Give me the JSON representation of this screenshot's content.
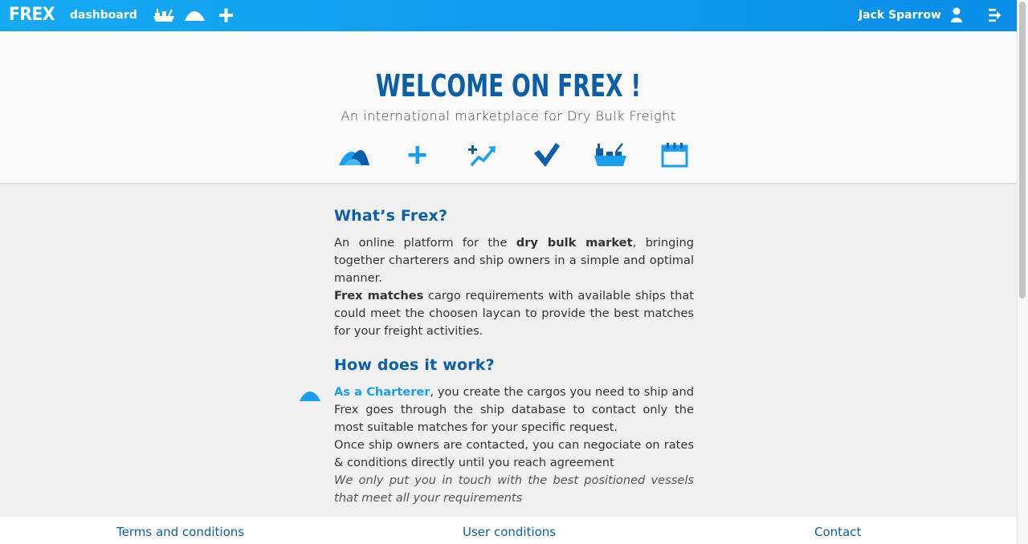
{
  "navbar": {
    "brand": "FREX",
    "dashboard_label": "dashboard",
    "icons": [
      "ship-icon",
      "cargo-pile-icon",
      "plus-icon"
    ],
    "user_name": "Jack Sparrow",
    "user_icon": "user-icon",
    "logout_icon": "logout-icon"
  },
  "hero": {
    "title": "WELCOME ON FREX !",
    "subtitle": "An international marketplace for Dry Bulk Freight",
    "icons": [
      "cargo-pile-icon",
      "plus-icon",
      "trend-up-icon",
      "checkmark-icon",
      "ship-icon",
      "calendar-icon"
    ]
  },
  "whats_frex": {
    "heading": "What’s Frex?",
    "p1_a": "An online platform for the ",
    "p1_bold": "dry bulk market",
    "p1_b": ", bringing together charterers and ship owners in a simple and optimal manner.",
    "p2_bold": "Frex matches",
    "p2_rest": " cargo requirements with available ships that could meet the choosen laycan to provide the best matches for your freight activities."
  },
  "how_it_works": {
    "heading": "How does it work?",
    "charterer_link": "As a Charterer",
    "charterer_text": ", you create the cargos you need to ship and Frex goes through the ship database to contact only the most suitable matches for your specific request.",
    "line2": "Once ship owners are contacted, you can negociate on rates & conditions directly until you reach agreement",
    "note": "We only put you in touch with the best positioned vessels that meet all your requirements"
  },
  "footer": {
    "terms": "Terms and conditions",
    "user_conditions": "User conditions",
    "contact": "Contact"
  },
  "colors": {
    "nav_blue": "#0a8ee8",
    "title_blue": "#0b5ea8",
    "icon_blue": "#1a9ff0"
  }
}
